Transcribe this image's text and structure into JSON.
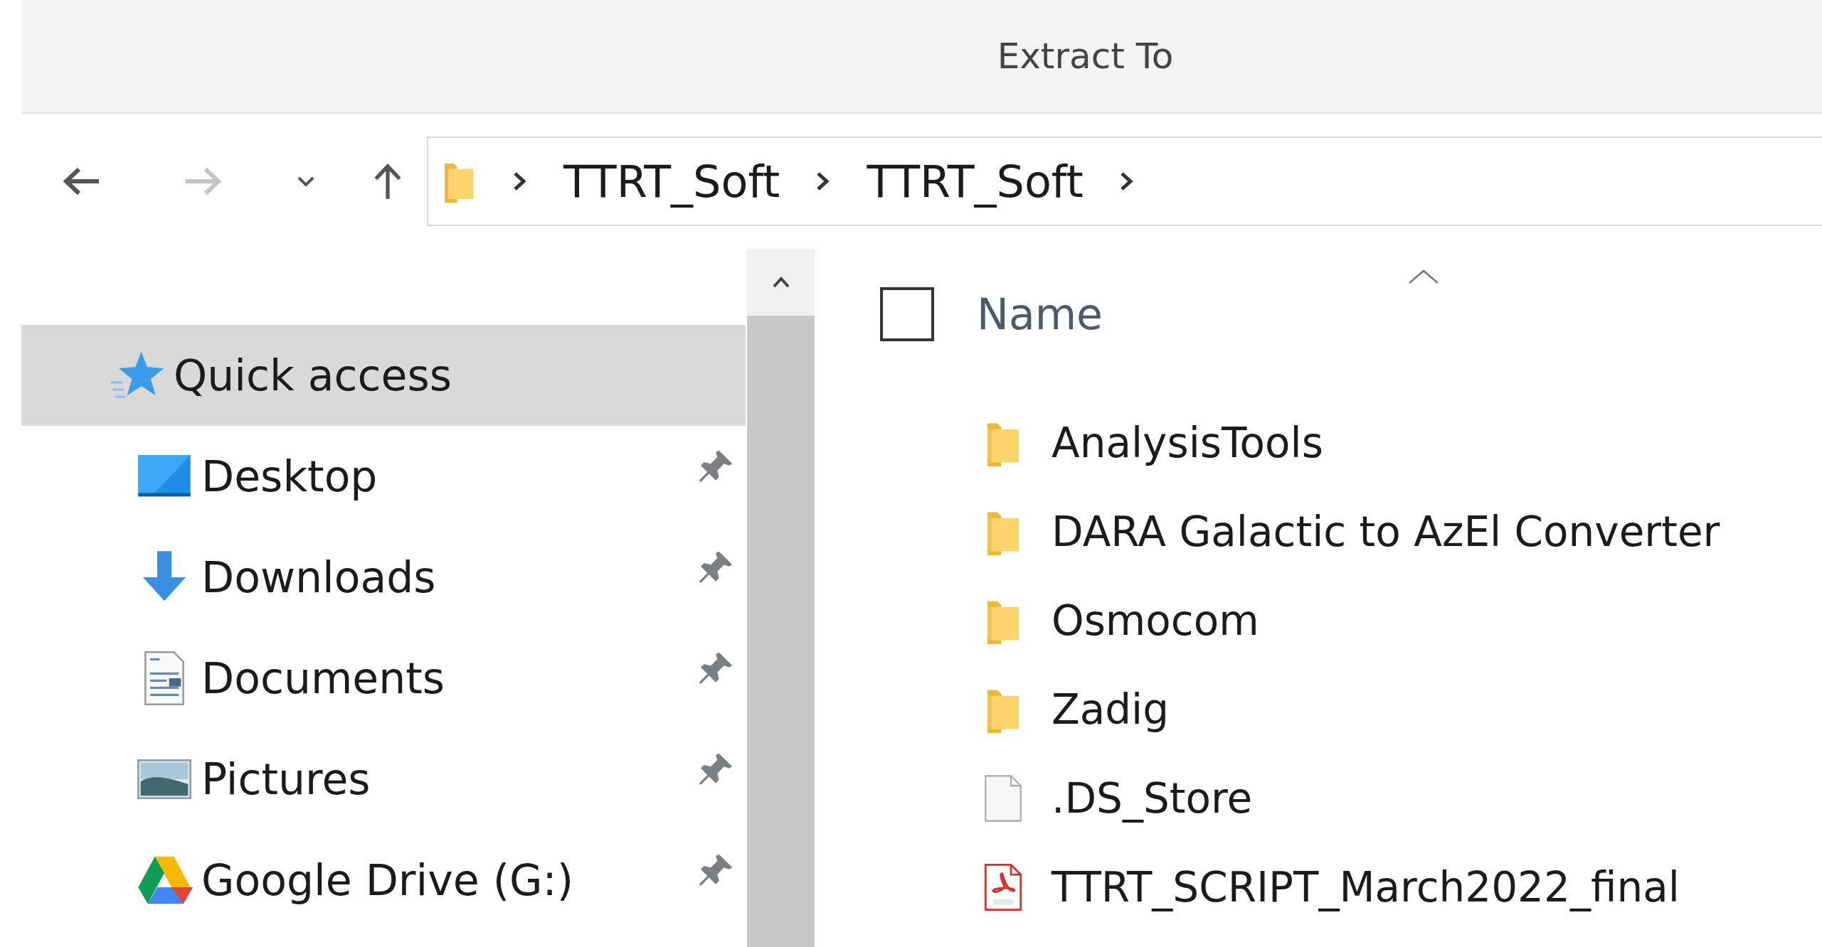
{
  "window": {
    "title": "Extract To"
  },
  "navigation": {
    "back": {
      "disabled": false
    },
    "forward": {
      "disabled": true
    }
  },
  "address_bar": {
    "path": [
      "TTRT_Soft",
      "TTRT_Soft"
    ]
  },
  "sidebar": {
    "items": [
      {
        "label": "Quick access",
        "kind": "star",
        "selected": true,
        "pinned": false
      },
      {
        "label": "Desktop",
        "kind": "desktop",
        "selected": false,
        "pinned": true
      },
      {
        "label": "Downloads",
        "kind": "downloads",
        "selected": false,
        "pinned": true
      },
      {
        "label": "Documents",
        "kind": "documents",
        "selected": false,
        "pinned": true
      },
      {
        "label": "Pictures",
        "kind": "pictures",
        "selected": false,
        "pinned": true
      },
      {
        "label": "Google Drive (G:)",
        "kind": "drive",
        "selected": false,
        "pinned": true
      }
    ]
  },
  "file_list": {
    "select_all": {
      "checked": false
    },
    "columns": [
      {
        "label": "Name",
        "sorted": true
      }
    ],
    "rows": [
      {
        "name": "AnalysisTools",
        "kind": "folder"
      },
      {
        "name": "DARA Galactic to AzEl Converter",
        "kind": "folder"
      },
      {
        "name": "Osmocom",
        "kind": "folder"
      },
      {
        "name": "Zadig",
        "kind": "folder"
      },
      {
        "name": ".DS_Store",
        "kind": "file"
      },
      {
        "name": "TTRT_SCRIPT_March2022_final",
        "kind": "pdf"
      }
    ]
  }
}
